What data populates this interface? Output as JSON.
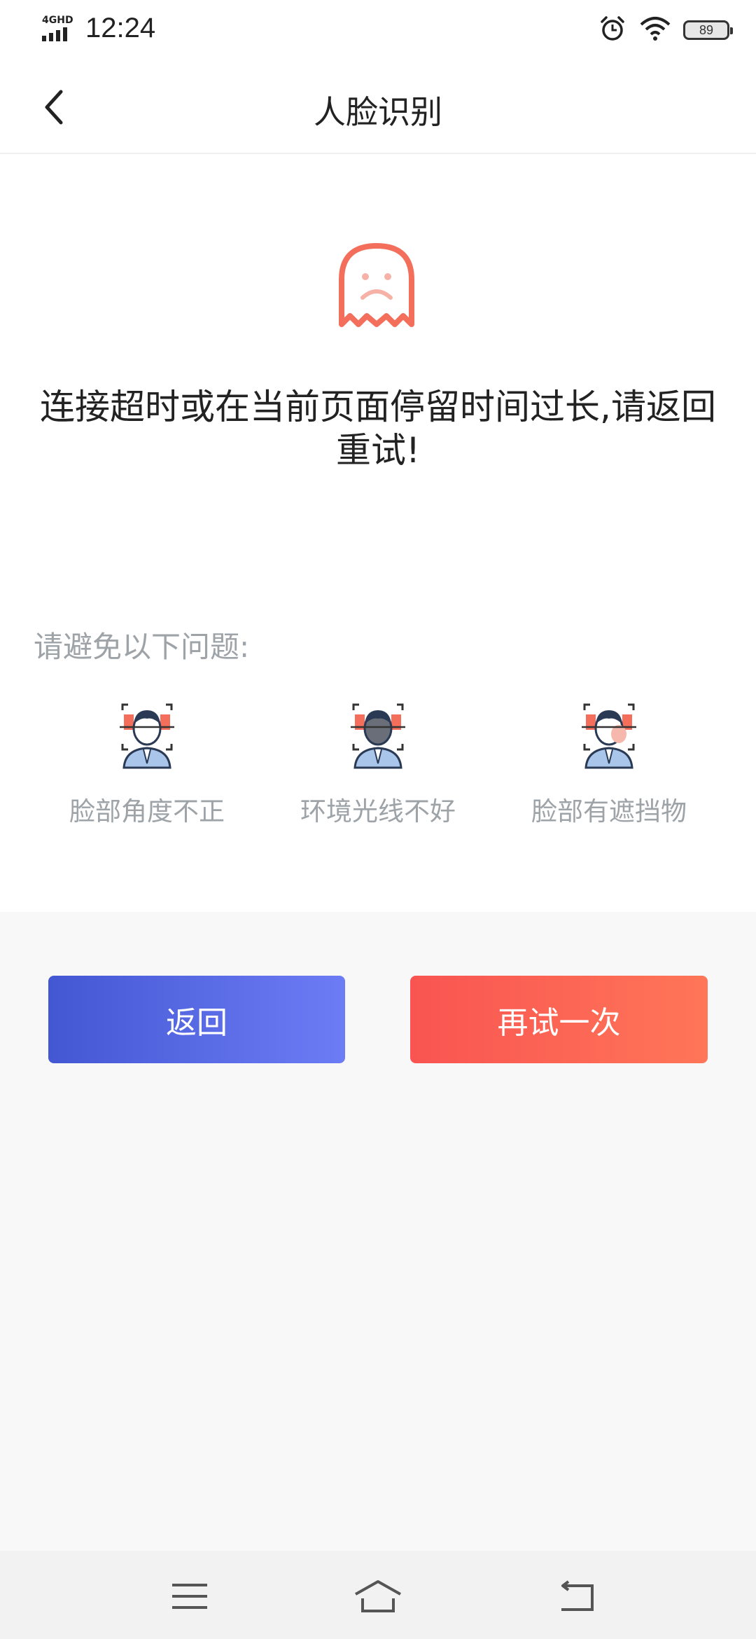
{
  "status_bar": {
    "network": "4GHD",
    "time": "12:24",
    "battery": "89",
    "icons": [
      "signal-icon",
      "alarm-icon",
      "wifi-icon",
      "battery-icon"
    ]
  },
  "nav": {
    "title": "人脸识别",
    "back_icon": "chevron-left-icon"
  },
  "main": {
    "illustration": "sad-ghost-icon",
    "error_message": "连接超时或在当前页面停留时间过长,请返回重试!",
    "tips_title": "请避免以下问题:",
    "tips": [
      {
        "label": "脸部角度不正",
        "icon": "face-angle-icon"
      },
      {
        "label": "环境光线不好",
        "icon": "poor-lighting-icon"
      },
      {
        "label": "脸部有遮挡物",
        "icon": "face-obstruction-icon"
      }
    ]
  },
  "actions": {
    "back_label": "返回",
    "retry_label": "再试一次"
  },
  "system_nav": {
    "icons": [
      "menu-icon",
      "home-icon",
      "back-icon"
    ]
  },
  "colors": {
    "back_gradient": [
      "#4457d3",
      "#6c7cf5"
    ],
    "retry_gradient": [
      "#f95451",
      "#ff7658"
    ],
    "ghost": "#f36f5c",
    "tip_text": "#9ea3a8"
  }
}
